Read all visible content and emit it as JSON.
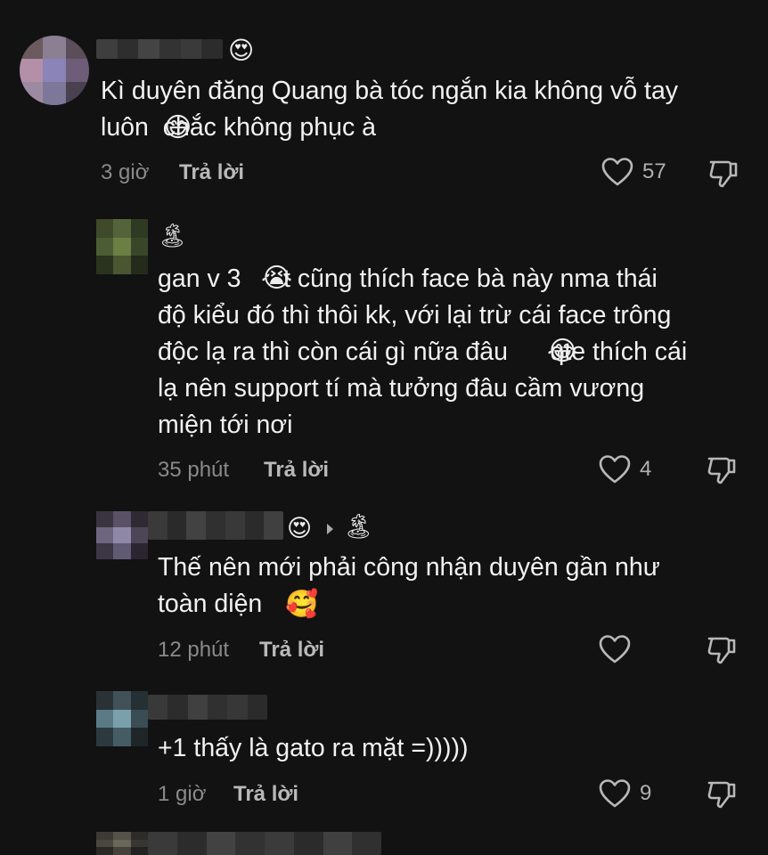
{
  "comments": [
    {
      "text": "Kì duyên đăng Quang bà tóc ngắn kia không vỗ tay\nluôn  chắc không phục à",
      "time": "3 giờ",
      "reply": "Trả lời",
      "likes": "57",
      "author_emoji": "😍",
      "inline_emoji": "😅"
    },
    {
      "text": "gan v 3      t cũng thích face bà này nma thái\nđộ kiểu đó thì thôi kk, với lại trừ cái face trông\nđộc lạ ra thì còn cái gì nữa đâu      qte thích cái\nlạ nên support tí mà tưởng đâu cầm vương\nmiện tới nơi",
      "time": "35 phút",
      "reply": "Trả lời",
      "likes": "4",
      "author_emoji": "🏝",
      "inline_emoji_1": "😭",
      "inline_emoji_2": "😂"
    },
    {
      "text": "Thế nên mới phải công nhận duyên gần như\ntoàn diện ",
      "time": "12 phút",
      "reply": "Trả lời",
      "likes": "",
      "author_emoji": "😍",
      "target_emoji": "🏝",
      "inline_emoji": "🥰"
    },
    {
      "text": "+1 thấy là gato ra mặt =)))))",
      "time": "1 giờ",
      "reply": "Trả lời",
      "likes": "9"
    }
  ],
  "icons": {
    "like": "heart-outline-icon",
    "dislike": "thumbs-down-outline-icon"
  }
}
